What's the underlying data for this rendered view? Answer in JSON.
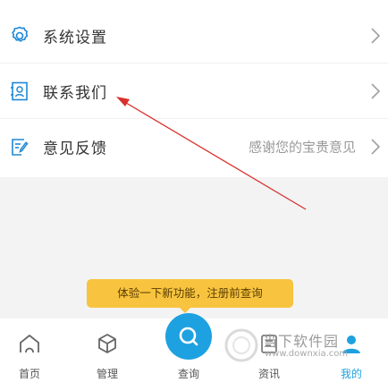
{
  "menu": {
    "items": [
      {
        "label": "系统设置",
        "icon": "gear-icon",
        "note": ""
      },
      {
        "label": "联系我们",
        "icon": "contact-card-icon",
        "note": ""
      },
      {
        "label": "意见反馈",
        "icon": "feedback-edit-icon",
        "note": "感谢您的宝贵意见"
      }
    ]
  },
  "tooltip": {
    "text": "体验一下新功能，注册前查询"
  },
  "tabbar": {
    "tabs": [
      {
        "label": "首页",
        "icon": "home-icon"
      },
      {
        "label": "管理",
        "icon": "box-icon"
      },
      {
        "label": "查询",
        "icon": "search-icon"
      },
      {
        "label": "资讯",
        "icon": "news-icon"
      },
      {
        "label": "我的",
        "icon": "user-icon"
      }
    ]
  },
  "watermark": {
    "brand": "当下软件园",
    "url": "www.downxia.com"
  },
  "colors": {
    "accent": "#1ea1e0",
    "tooltip_bg": "#f8c43f",
    "annotation_arrow": "#d9302c",
    "active_tab": "#1ea1e0"
  }
}
